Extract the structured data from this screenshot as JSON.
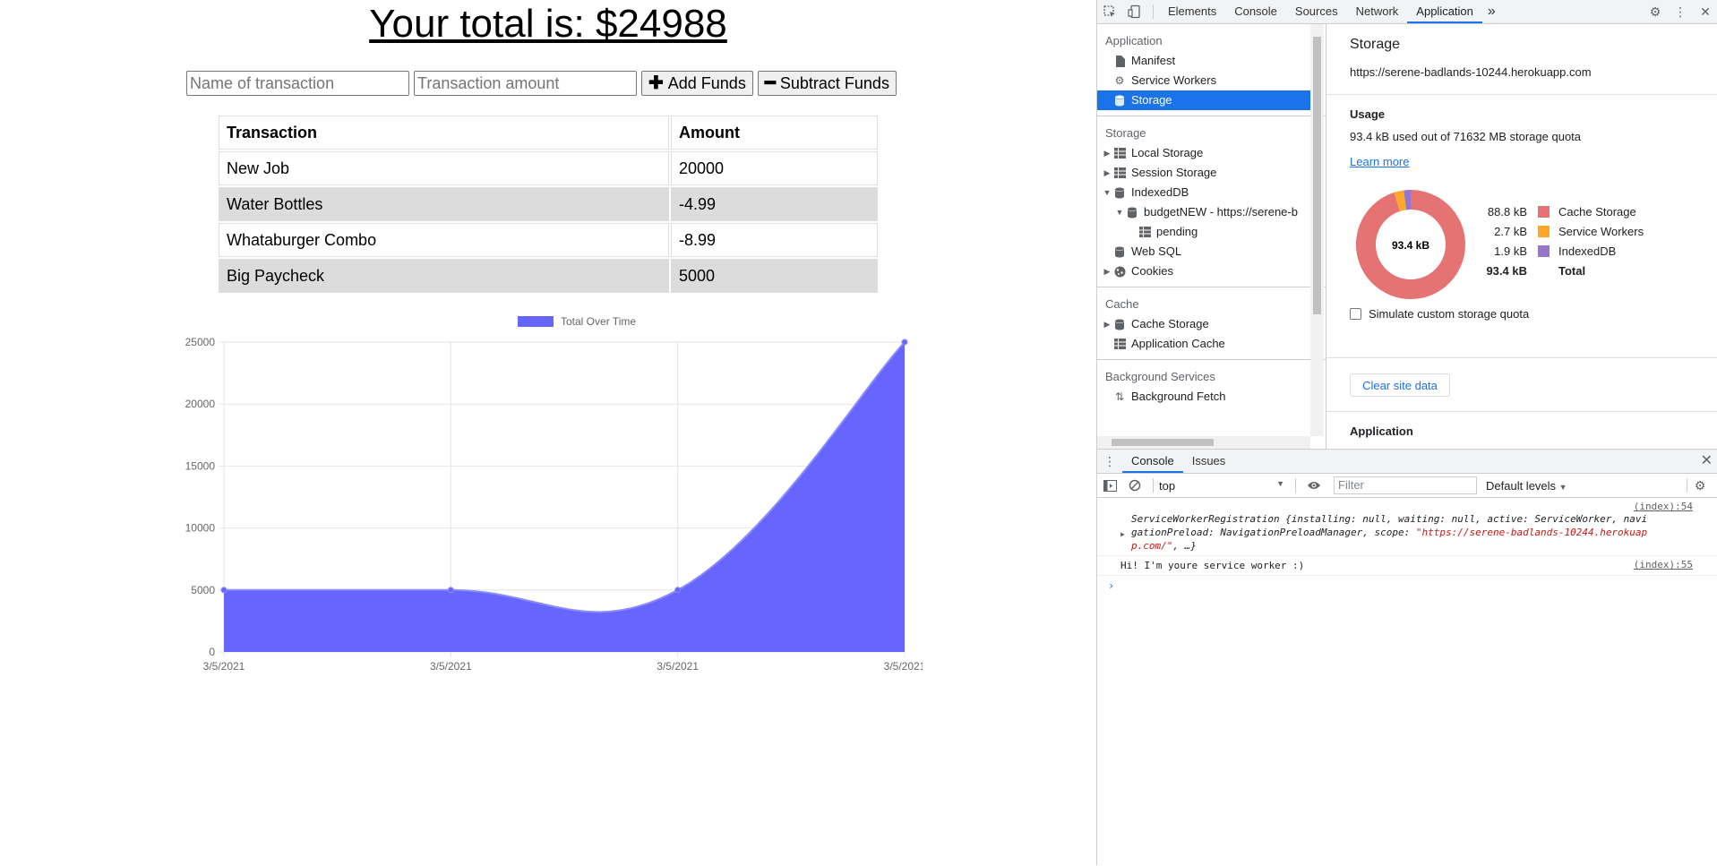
{
  "page": {
    "title": "Your total is: $24988",
    "form": {
      "name_placeholder": "Name of transaction",
      "amount_placeholder": "Transaction amount",
      "add_label": "Add Funds",
      "subtract_label": "Subtract Funds"
    },
    "table": {
      "headers": [
        "Transaction",
        "Amount"
      ],
      "rows": [
        {
          "name": "New Job",
          "amount": "20000"
        },
        {
          "name": "Water Bottles",
          "amount": "-4.99"
        },
        {
          "name": "Whataburger Combo",
          "amount": "-8.99"
        },
        {
          "name": "Big Paycheck",
          "amount": "5000"
        }
      ]
    }
  },
  "chart_data": {
    "type": "area",
    "categories": [
      "3/5/2021",
      "3/5/2021",
      "3/5/2021",
      "3/5/2021"
    ],
    "series": [
      {
        "name": "Total Over Time",
        "values": [
          5000,
          5000,
          5000,
          25000
        ],
        "color": "#6666ff"
      }
    ],
    "title": "",
    "xlabel": "",
    "ylabel": "",
    "ylim": [
      0,
      25000
    ],
    "yticks": [
      0,
      5000,
      10000,
      15000,
      20000,
      25000
    ],
    "legend": "top",
    "grid": true
  },
  "devtools": {
    "tabs": [
      "Elements",
      "Console",
      "Sources",
      "Network",
      "Application"
    ],
    "more_tabs": "»",
    "sidebar": {
      "application_header": "Application",
      "application_items": [
        "Manifest",
        "Service Workers",
        "Storage"
      ],
      "storage_header": "Storage",
      "storage_items": {
        "local": "Local Storage",
        "session": "Session Storage",
        "indexeddb": "IndexedDB",
        "db": "budgetNEW - https://serene-b",
        "store": "pending",
        "websql": "Web SQL",
        "cookies": "Cookies"
      },
      "cache_header": "Cache",
      "cache_items": [
        "Cache Storage",
        "Application Cache"
      ],
      "bg_header": "Background Services",
      "bg_items": [
        "Background Fetch"
      ]
    },
    "storage": {
      "title": "Storage",
      "url": "https://serene-badlands-10244.herokuapp.com",
      "usage_header": "Usage",
      "usage_text": "93.4 kB used out of 71632 MB storage quota",
      "learn_more": "Learn more",
      "donut_center": "93.4 kB",
      "legend": [
        {
          "size": "88.8 kB",
          "label": "Cache Storage",
          "color": "#e57373",
          "value": 88.8
        },
        {
          "size": "2.7 kB",
          "label": "Service Workers",
          "color": "#ffa726",
          "value": 2.7
        },
        {
          "size": "1.9 kB",
          "label": "IndexedDB",
          "color": "#9575cd",
          "value": 1.9
        }
      ],
      "total_size": "93.4 kB",
      "total_label": "Total",
      "simulate_label": "Simulate custom storage quota",
      "clear_label": "Clear site data",
      "application_header": "Application"
    },
    "drawer": {
      "tabs": [
        "Console",
        "Issues"
      ],
      "context": "top",
      "filter_placeholder": "Filter",
      "levels": "Default levels",
      "messages": {
        "m1_src": "(index):54",
        "m1_line1": "ServiceWorkerRegistration {installing: null, waiting: null, active: ServiceWorker, navi",
        "m1_line2a": "gationPreload: NavigationPreloadManager, scope: ",
        "m1_line2b": "\"https://serene-badlands-10244.herokuap",
        "m1_line3a": "p.com/\"",
        "m1_line3b": ", …}",
        "m2_text": "Hi! I'm youre service worker :)",
        "m2_src": "(index):55"
      }
    }
  }
}
